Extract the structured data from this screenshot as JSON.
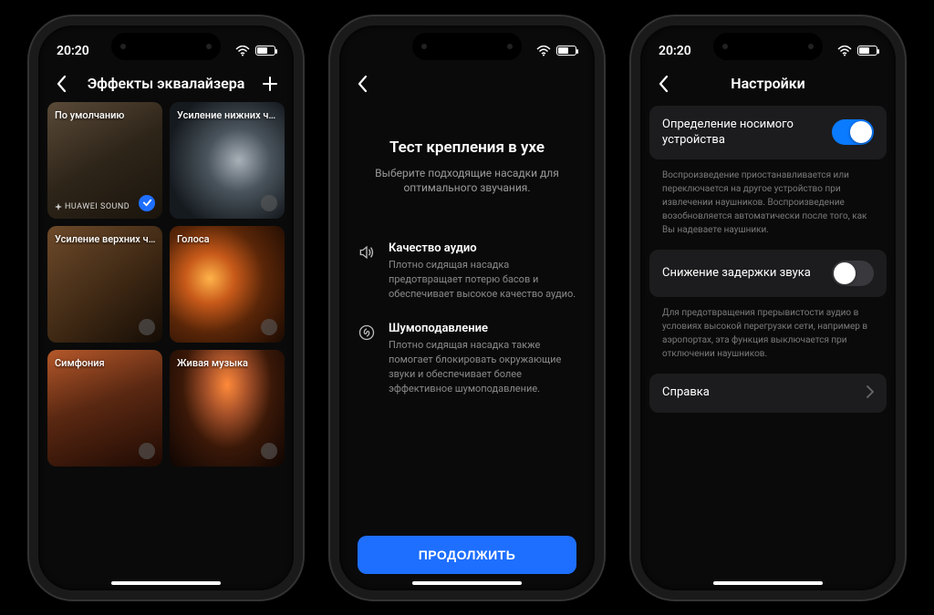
{
  "status": {
    "time": "20:20",
    "battery": "59"
  },
  "screen1": {
    "title": "Эффекты эквалайзера",
    "cards": [
      {
        "label": "По умолчанию",
        "tag": "HUAWEI SOUND",
        "selected": true
      },
      {
        "label": "Усиление нижних час…",
        "selected": false
      },
      {
        "label": "Усиление верхних ча…",
        "selected": false
      },
      {
        "label": "Голоса",
        "selected": false
      },
      {
        "label": "Симфония",
        "selected": false
      },
      {
        "label": "Живая музыка",
        "selected": false
      }
    ]
  },
  "screen2": {
    "title": "Тест крепления в ухе",
    "subtitle": "Выберите подходящие насадки для оптимального звучания.",
    "items": [
      {
        "heading": "Качество аудио",
        "body": "Плотно сидящая насадка предотвращает потерю басов и обеспечивает высокое качество аудио."
      },
      {
        "heading": "Шумоподавление",
        "body": "Плотно сидящая насадка также помогает блокировать окружающие звуки и обеспечивает более эффективное шумоподавление."
      }
    ],
    "cta": "ПРОДОЛЖИТЬ"
  },
  "screen3": {
    "title": "Настройки",
    "wear_detect": {
      "label": "Определение носимого устройства",
      "desc": "Воспроизведение приостанавливается или переключается на другое устройство при извлечении наушников. Воспроизведение возобновляется автоматически после того, как Вы надеваете наушники."
    },
    "low_latency": {
      "label": "Снижение задержки звука",
      "desc": "Для предотвращения прерывистости аудио в условиях высокой перегрузки сети, например в аэропортах, эта функция выключается при отключении наушников."
    },
    "help": {
      "label": "Справка"
    }
  }
}
